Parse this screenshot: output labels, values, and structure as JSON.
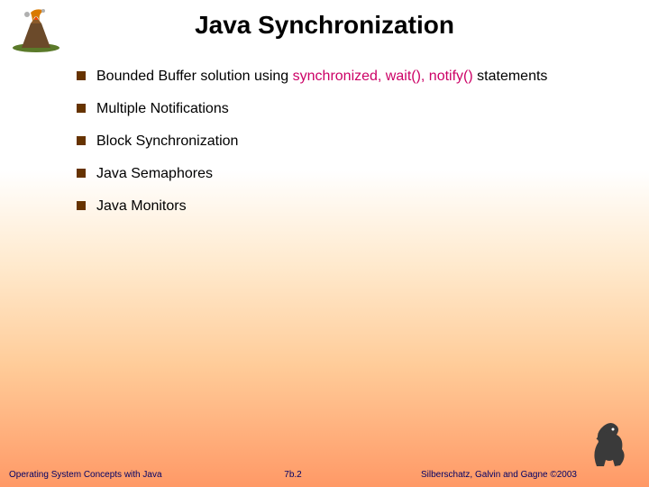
{
  "title": "Java Synchronization",
  "bullets": [
    {
      "pre": "Bounded Buffer solution using ",
      "hl": "synchronized, wait(), notify()",
      "post": " statements"
    },
    {
      "pre": "Multiple Notifications",
      "hl": "",
      "post": ""
    },
    {
      "pre": "Block Synchronization",
      "hl": "",
      "post": ""
    },
    {
      "pre": "Java Semaphores",
      "hl": "",
      "post": ""
    },
    {
      "pre": "Java Monitors",
      "hl": "",
      "post": ""
    }
  ],
  "footer": {
    "left": "Operating System Concepts with Java",
    "center": "7b.2",
    "right": "Silberschatz, Galvin and Gagne ©2003"
  }
}
